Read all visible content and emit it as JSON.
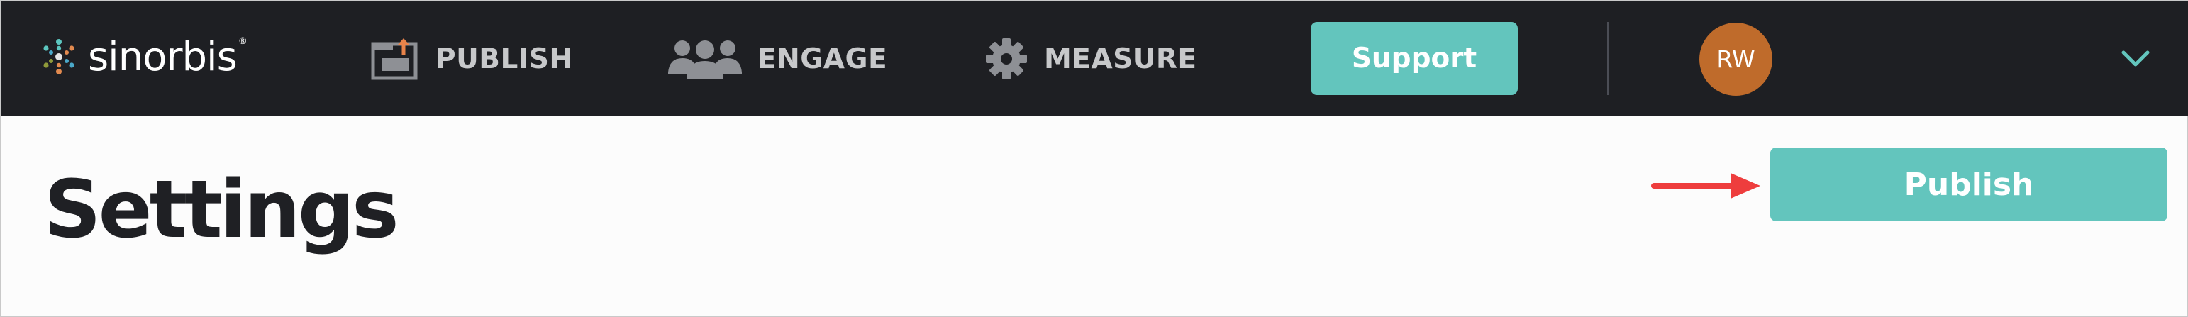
{
  "brand": {
    "name": "sinorbis",
    "registered_mark": "®"
  },
  "nav": {
    "items": [
      {
        "label": "PUBLISH",
        "icon": "publish-icon"
      },
      {
        "label": "ENGAGE",
        "icon": "users-icon"
      },
      {
        "label": "MEASURE",
        "icon": "gear-icon"
      }
    ]
  },
  "header": {
    "support_label": "Support",
    "user_initials": "RW",
    "menu_icon": "chevron-down-icon"
  },
  "page": {
    "title": "Settings",
    "publish_label": "Publish",
    "annotation_icon": "red-arrow-icon"
  },
  "colors": {
    "topbar": "#1e1f23",
    "accent": "#63c5bd",
    "avatar": "#bf6b2b",
    "nav_text": "#c7c8ca",
    "annotation": "#ee3d3d"
  }
}
